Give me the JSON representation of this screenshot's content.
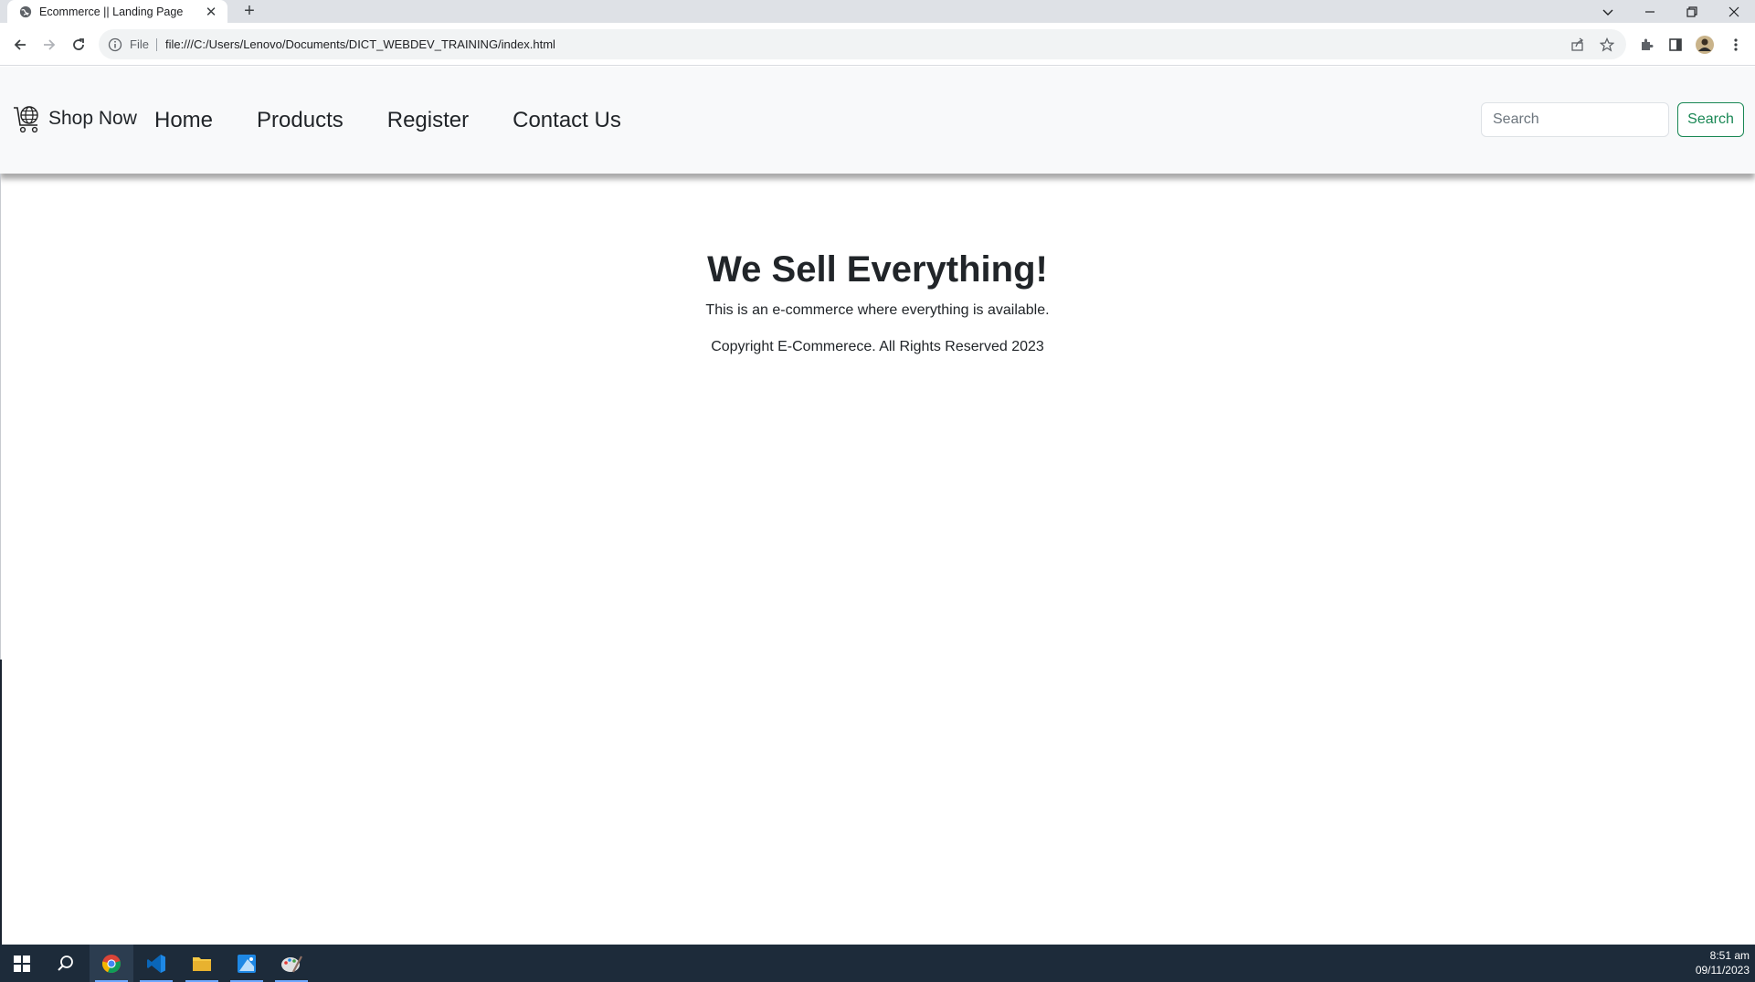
{
  "browser": {
    "tab_title": "Ecommerce || Landing Page",
    "close_glyph": "✕",
    "new_tab_glyph": "+",
    "file_label": "File",
    "url": "file:///C:/Users/Lenovo/Documents/DICT_WEBDEV_TRAINING/index.html"
  },
  "site": {
    "brand": "Shop Now",
    "nav": [
      "Home",
      "Products",
      "Register",
      "Contact Us"
    ],
    "search_placeholder": "Search",
    "search_button": "Search",
    "accent_color": "#198754"
  },
  "hero": {
    "heading": "We Sell Everything!",
    "tagline": "This is an e-commerce where everything is available.",
    "copyright": "Copyright E-Commerece. All Rights Reserved 2023"
  },
  "taskbar": {
    "time": "8:51 am",
    "date": "09/11/2023"
  }
}
